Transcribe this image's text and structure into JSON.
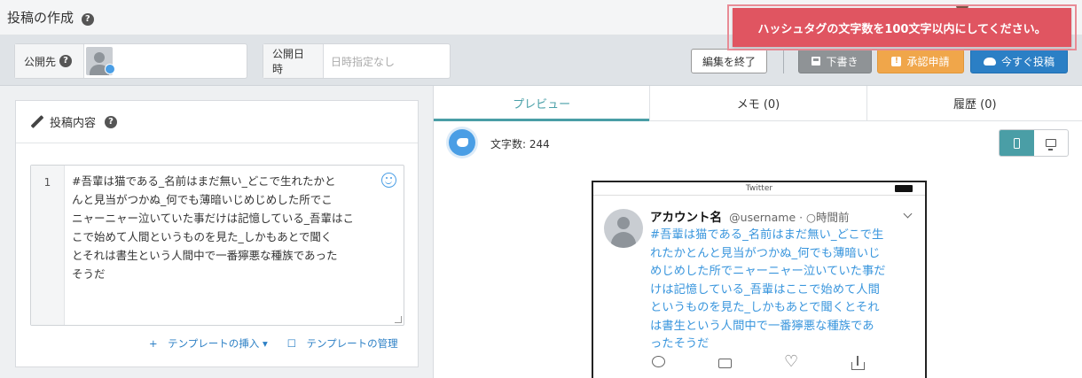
{
  "header": {
    "title": "投稿の作成",
    "help": "?"
  },
  "toast": {
    "message": "ハッシュタグの文字数を100文字以内にしてください。"
  },
  "toolbar": {
    "destination_label": "公開先",
    "help": "?",
    "datetime_label": "公開日時",
    "datetime_placeholder": "日時指定なし",
    "end_edit_label": "編集を終了",
    "draft_label": "下書き",
    "approve_label": "承認申請",
    "post_now_label": "今すぐ投稿"
  },
  "editor": {
    "title": "投稿内容",
    "help": "?",
    "line_number": "1",
    "text": "#吾輩は猫である_名前はまだ無い_どこで生れたかと\nんと見当がつかぬ_何でも薄暗いじめじめした所でこ\nニャーニャー泣いていた事だけは記憶している_吾輩はこ\nこで始めて人間というものを見た_しかもあとで聞く\nとそれは書生という人間中で一番獰悪な種族であった\nそうだ",
    "insert_template": "+　テンプレートの挿入 ▾",
    "manage_template": "☐　テンプレートの管理"
  },
  "tabs": [
    {
      "label": "プレビュー",
      "active": true
    },
    {
      "label": "メモ (0)",
      "active": false
    },
    {
      "label": "履歴 (0)",
      "active": false
    }
  ],
  "preview": {
    "char_count": "文字数: 244",
    "phone_title": "Twitter",
    "account_name": "アカウント名",
    "account_meta": "@username · ○時間前",
    "tweet_text": "#吾輩は猫である_名前はまだ無い_どこで生\nれたかとんと見当がつかぬ_何でも薄暗いじ\nめじめした所でニャーニャー泣いていた事だ\nけは記憶している_吾輩はここで始めて人間\nというものを見た_しかもあとで聞くとそれ\nは書生という人間中で一番獰悪な種族であ\nったそうだ"
  },
  "colors": {
    "toast": "#e05561",
    "approve": "#f0a64a",
    "post": "#2b7fc5",
    "accent": "#4a9ea6",
    "twitter": "#4a9ee5"
  }
}
